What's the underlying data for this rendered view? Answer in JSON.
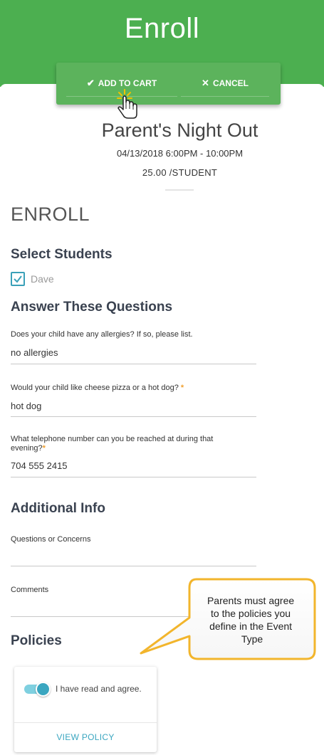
{
  "header": {
    "title": "Enroll"
  },
  "actions": {
    "add_to_cart": "ADD TO CART",
    "cancel": "CANCEL"
  },
  "event": {
    "name": "Parent's Night Out",
    "date": "04/13/2018 6:00PM - 10:00PM",
    "price": "25.00 /STUDENT"
  },
  "form": {
    "heading": "ENROLL",
    "select_students": {
      "title": "Select Students",
      "students": [
        {
          "name": "Dave",
          "checked": true
        }
      ]
    },
    "questions": {
      "title": "Answer These Questions",
      "items": [
        {
          "label": "Does your child have any allergies? If so, please list.",
          "required": false,
          "value": "no allergies"
        },
        {
          "label": "Would your child like cheese pizza or a hot dog?",
          "required": true,
          "value": "hot dog"
        },
        {
          "label": "What telephone number can you be reached at during that evening?",
          "required": true,
          "value": "704 555 2415"
        }
      ],
      "required_mark": "*"
    },
    "additional": {
      "title": "Additional Info",
      "questions_label": "Questions or Concerns",
      "questions_value": "",
      "comments_label": "Comments",
      "comments_value": ""
    },
    "policies": {
      "title": "Policies",
      "agree_label": "I have read and agree.",
      "agreed": true,
      "view_policy": "VIEW POLICY"
    }
  },
  "callout": {
    "lines": [
      "Parents must agree",
      "to the policies you",
      "define in the Event",
      "Type"
    ]
  },
  "colors": {
    "header_green": "#4caf50",
    "accent_teal": "#3aa6c0",
    "required_orange": "#f0a030",
    "callout_border": "#f2b52c"
  }
}
